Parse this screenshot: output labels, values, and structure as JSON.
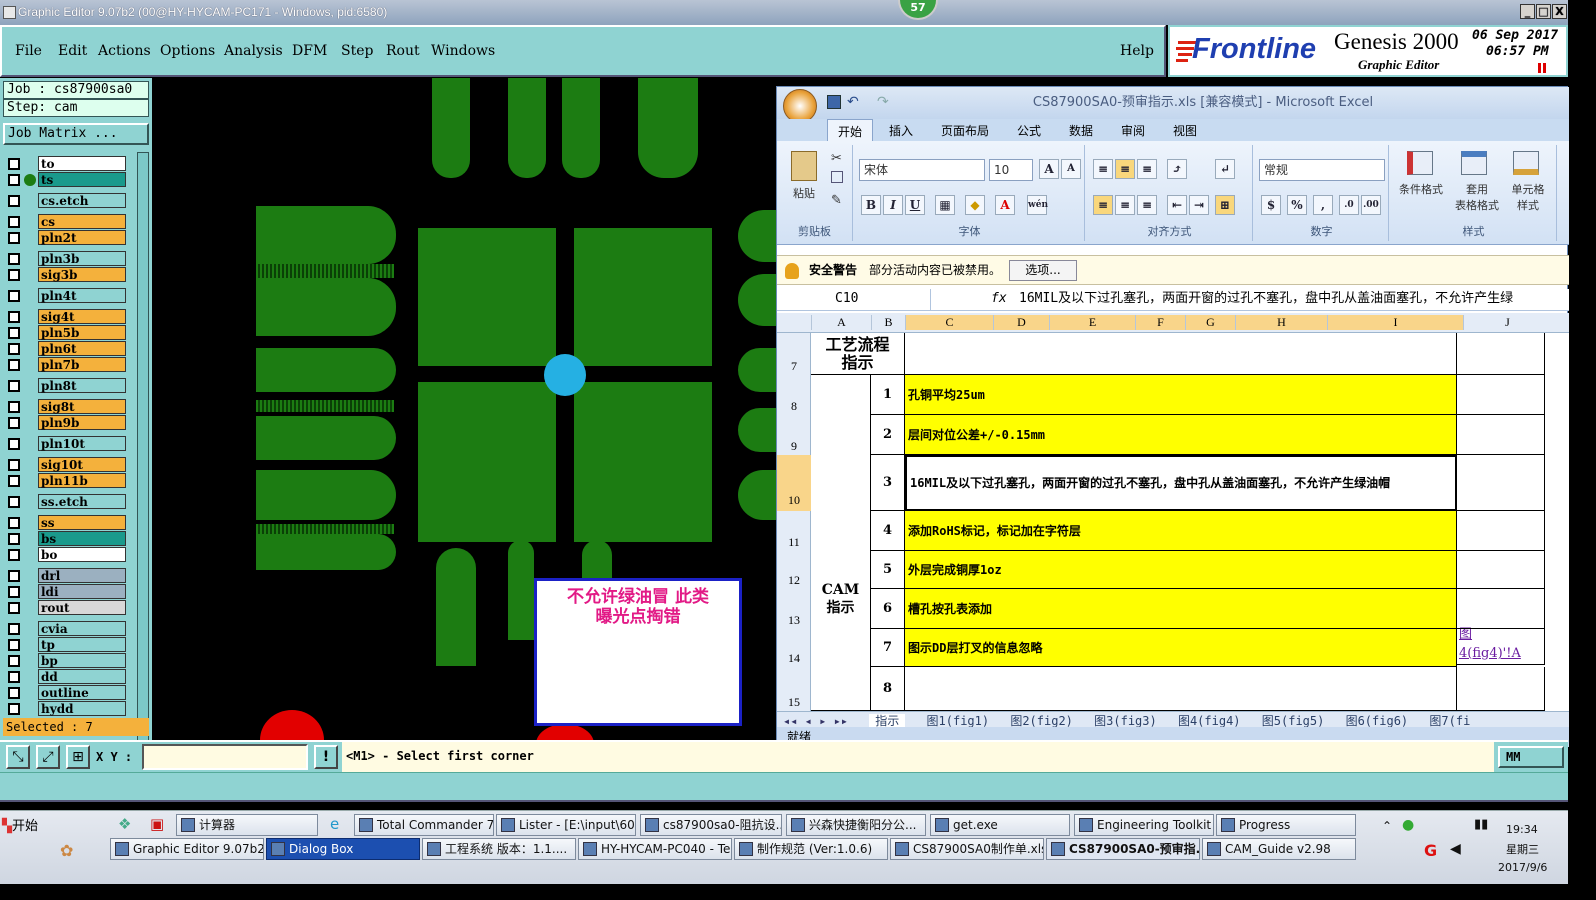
{
  "window": {
    "title": "Graphic Editor 9.07b2 (00@HY-HYCAM-PC171 - Windows, pid:6580)",
    "badge": "57",
    "controls": {
      "minimize": "_",
      "restore": "□",
      "close": "X"
    }
  },
  "menu": {
    "items": [
      "File",
      "Edit",
      "Actions",
      "Options",
      "Analysis",
      "DFM",
      "Step",
      "Rout",
      "Windows"
    ],
    "help": "Help"
  },
  "brand": {
    "logo": "Frontline",
    "product": "Genesis 2000",
    "subtitle": "Graphic Editor",
    "date": "06  Sep  2017",
    "time": "06:57  PM"
  },
  "job": {
    "job_line": "Job : cs87900sa0",
    "step_line": "Step: cam",
    "matrix_button": "Job Matrix ..."
  },
  "layers": [
    {
      "name": "to",
      "color": "#ffffff"
    },
    {
      "name": "ts",
      "color": "#1a9a8c"
    },
    {
      "name": "cs.etch",
      "color": "#8fd3d2"
    },
    {
      "name": "cs",
      "color": "#f4b13c"
    },
    {
      "name": "pln2t",
      "color": "#f4b13c"
    },
    {
      "name": "pln3b",
      "color": "#8fd3d2"
    },
    {
      "name": "sig3b",
      "color": "#f4b13c"
    },
    {
      "name": "pln4t",
      "color": "#8fd3d2"
    },
    {
      "name": "sig4t",
      "color": "#f4b13c"
    },
    {
      "name": "pln5b",
      "color": "#f4b13c"
    },
    {
      "name": "pln6t",
      "color": "#f4b13c"
    },
    {
      "name": "pln7b",
      "color": "#f4b13c"
    },
    {
      "name": "pln8t",
      "color": "#8fd3d2"
    },
    {
      "name": "sig8t",
      "color": "#f4b13c"
    },
    {
      "name": "pln9b",
      "color": "#f4b13c"
    },
    {
      "name": "pln10t",
      "color": "#8fd3d2"
    },
    {
      "name": "sig10t",
      "color": "#f4b13c"
    },
    {
      "name": "pln11b",
      "color": "#f4b13c"
    },
    {
      "name": "ss.etch",
      "color": "#8fd3d2"
    },
    {
      "name": "ss",
      "color": "#f4b13c"
    },
    {
      "name": "bs",
      "color": "#1a9a8c"
    },
    {
      "name": "bo",
      "color": "#ffffff"
    },
    {
      "name": "drl",
      "color": "#9bb0c0"
    },
    {
      "name": "ldi",
      "color": "#9bb0c0"
    },
    {
      "name": "rout",
      "color": "#d8d8d8"
    },
    {
      "name": "cvia",
      "color": "#8fd3d2"
    },
    {
      "name": "tp",
      "color": "#8fd3d2"
    },
    {
      "name": "bp",
      "color": "#8fd3d2"
    },
    {
      "name": "dd",
      "color": "#8fd3d2"
    },
    {
      "name": "outline",
      "color": "#8fd3d2"
    },
    {
      "name": "hydd",
      "color": "#8fd3d2"
    }
  ],
  "selected_text": "Selected : 7",
  "canvas_note": {
    "line1": "不允许绿油冒   此类",
    "line2": "曝光点掏错"
  },
  "excel": {
    "title": "CS87900SA0-预审指示.xls  [兼容模式] - Microsoft Excel",
    "tabs": [
      "开始",
      "插入",
      "页面布局",
      "公式",
      "数据",
      "审阅",
      "视图"
    ],
    "groups": {
      "clipboard": "剪贴板",
      "font": "字体",
      "align": "对齐方式",
      "number": "数字",
      "styles": "样式"
    },
    "paste": "粘贴",
    "font_name": "宋体",
    "font_size": "10",
    "number_format": "常规",
    "style_buttons": [
      "条件格式",
      "套用\n表格格式",
      "单元格\n样式"
    ],
    "security": {
      "label": "安全警告",
      "text": "部分活动内容已被禁用。",
      "button": "选项..."
    },
    "name_box": "C10",
    "fx": "fx",
    "formula": "16MIL及以下过孔塞孔，两面开窗的过孔不塞孔，盘中孔从盖油面塞孔，不允许产生绿",
    "columns": [
      "A",
      "B",
      "C",
      "D",
      "E",
      "F",
      "G",
      "H",
      "I",
      "J"
    ],
    "row_numbers": [
      "7",
      "8",
      "9",
      "10",
      "11",
      "12",
      "13",
      "14",
      "15"
    ],
    "header_cell": "工艺流程\n指示",
    "group_cell": "CAM\n指示",
    "rows": [
      {
        "n": "1",
        "text": "孔铜平均25um"
      },
      {
        "n": "2",
        "text": "层间对位公差+/-0.15mm"
      },
      {
        "n": "3",
        "text": "16MIL及以下过孔塞孔，两面开窗的过孔不塞孔，盘中孔从盖油面塞孔，不允许产生绿油帽"
      },
      {
        "n": "4",
        "text": "添加RoHS标记，标记加在字符层"
      },
      {
        "n": "5",
        "text": "外层完成铜厚1oz"
      },
      {
        "n": "6",
        "text": "槽孔按孔表添加"
      },
      {
        "n": "7",
        "text": "图示DD层打叉的信息忽略"
      },
      {
        "n": "8",
        "text": ""
      }
    ],
    "link_cell": "图\n4(fig4)'!A",
    "sheets": [
      "指示",
      "图1(fig1)",
      "图2(fig2)",
      "图3(fig3)",
      "图4(fig4)",
      "图5(fig5)",
      "图6(fig6)",
      "图7(fi"
    ],
    "status": "就绪"
  },
  "bottom": {
    "xy_label": "X Y :",
    "xy_value": "",
    "excl": "!",
    "prompt": "<M1> - Select first corner",
    "units": "MM"
  },
  "taskbar": {
    "start": "开始",
    "row1": [
      "计算器",
      "Total Commander 7.0...",
      "Lister - [E:\\input\\600...",
      "cs87900sa0-阻抗设...",
      "兴森快捷衡阳分公...",
      "get.exe",
      "Engineering Toolkit 9....",
      "Progress"
    ],
    "row2": [
      "Graphic Editor 9.07b2 (0...",
      "Dialog Box",
      "工程系统  版本：1.1....",
      "HY-HYCAM-PC040 - Tea...",
      "制作规范 (Ver:1.0.6)",
      "CS87900SA0制作单.xls ...",
      "CS87900SA0-预审指...",
      "CAM_Guide v2.98"
    ],
    "clock": "19:34",
    "weekday": "星期三",
    "date": "2017/9/6"
  }
}
